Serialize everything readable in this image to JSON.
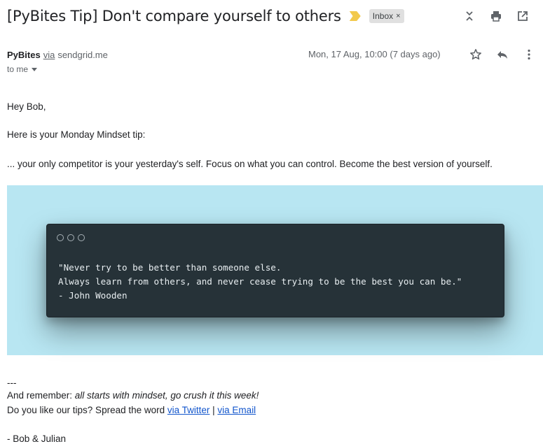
{
  "email": {
    "subject": "[PyBites Tip] Don't compare yourself to others",
    "label": "Inbox",
    "label_remove": "×",
    "sender_name": "PyBites",
    "sender_via": "via",
    "sender_domain": "sendgrid.me",
    "date": "Mon, 17 Aug, 10:00 (7 days ago)",
    "to": "to me"
  },
  "body": {
    "greeting": "Hey Bob,",
    "intro": "Here is your Monday Mindset tip:",
    "tip": "... your only competitor is your yesterday's self. Focus on what you can control. Become the best version of yourself.",
    "quote_line1": "\"Never try to be better than someone else.",
    "quote_line2": "Always learn from others, and never cease trying to be the best you can be.\"",
    "quote_line3": "- John Wooden",
    "separator": "---",
    "remember_prefix": "And remember: ",
    "remember_italic": "all starts with mindset, go crush it this week!",
    "share_prefix": "Do you like our tips? Spread the word ",
    "share_twitter": "via Twitter",
    "share_sep": " | ",
    "share_email": "via Email",
    "signature": "- Bob & Julian"
  },
  "icons": {
    "expand": "expand-collapse-icon",
    "print": "print-icon",
    "popout": "open-in-new-window-icon",
    "star": "star-icon",
    "reply": "reply-icon",
    "more": "more-vert-icon"
  },
  "colors": {
    "importance": "#f2c94c",
    "banner_bg": "#b8e6f2",
    "terminal_bg": "#263238",
    "link": "#1155cc"
  }
}
